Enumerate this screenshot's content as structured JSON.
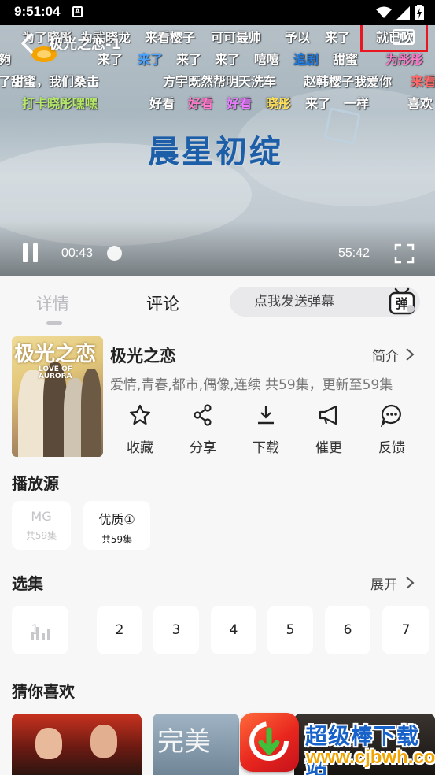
{
  "status_bar": {
    "time": "9:51:04",
    "notification_glyph": "A",
    "icons": [
      "wifi-icon",
      "signal-icon",
      "battery-charging-icon"
    ]
  },
  "player": {
    "episode_title": "极光之恋-1",
    "headline_overlay": "晨星初绽",
    "current_time": "00:43",
    "duration": "55:42",
    "tv_button_glyph": "TV",
    "danmu_rows": [
      [
        "为了晓彤",
        "为武晓龙",
        "来看樱子",
        "可可最帅",
        "予以",
        "来了",
        "就已吹"
      ],
      [
        "夠",
        "来了",
        "来了",
        "来了",
        "来了",
        "嘻嘻",
        "追剧",
        "甜蜜",
        "为彤彤"
      ],
      [
        "了甜蜜，我们桑击",
        "方宇既然帮明天洗车",
        "赵韩樱子我爱你",
        "来看"
      ],
      [
        "打卡晓彤嘿嘿",
        "好看",
        "好看",
        "好看",
        "晓彤",
        "来了",
        "一样",
        "喜欢"
      ]
    ]
  },
  "tabs": {
    "detail": "详情",
    "comments": "评论",
    "danmu_placeholder": "点我发送弹幕",
    "danmu_button_glyph": "弹"
  },
  "show": {
    "poster_title": "极光之恋",
    "poster_subtitle": "LOVE OF AURORA",
    "title": "极光之恋",
    "intro_label": "简介",
    "meta": "爱情,青春,都市,偶像,连续 共59集，更新至59集"
  },
  "actions": [
    {
      "label": "收藏",
      "icon": "star-icon"
    },
    {
      "label": "分享",
      "icon": "share-icon"
    },
    {
      "label": "下载",
      "icon": "download-icon"
    },
    {
      "label": "催更",
      "icon": "megaphone-icon"
    },
    {
      "label": "反馈",
      "icon": "chat-bubble-icon"
    }
  ],
  "sources": {
    "title": "播放源",
    "items": [
      {
        "name": "MG",
        "count": "共59集",
        "selected": false
      },
      {
        "name": "优质①",
        "count": "共59集",
        "selected": true
      }
    ]
  },
  "episodes": {
    "title": "选集",
    "expand_label": "展开",
    "items": [
      "1",
      "2",
      "3",
      "4",
      "5",
      "6",
      "7"
    ],
    "playing_index": 0
  },
  "recommend": {
    "title": "猜你喜欢",
    "card_2_overlay": "完美"
  },
  "watermark": {
    "title": "超级棒下载站",
    "url": "www.cjbwh.com"
  },
  "colors": {
    "accent_red": "#e8161e",
    "danmu_blue": "#4aa3ff",
    "danmu_pink": "#ff7acb",
    "danmu_green": "#b6e86a",
    "page_bg": "#f7f7f8"
  }
}
